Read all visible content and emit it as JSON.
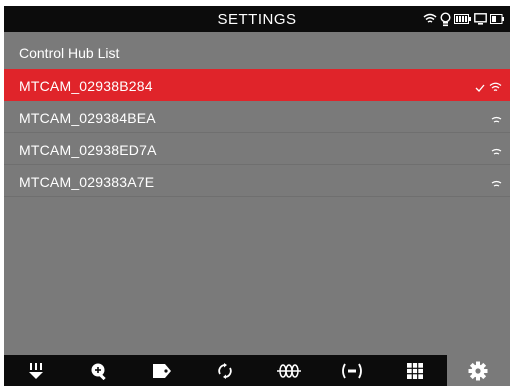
{
  "header": {
    "title": "SETTINGS"
  },
  "status_icons": [
    "wifi-icon",
    "lightbulb-icon",
    "battery-icon",
    "monitor-icon",
    "camera-battery-icon"
  ],
  "list": {
    "heading": "Control Hub List",
    "hubs": [
      {
        "name": "MTCAM_02938B284",
        "selected": true,
        "connected": true,
        "icon": "wifi-icon"
      },
      {
        "name": "MTCAM_029384BEA",
        "selected": false,
        "connected": false,
        "icon": "wifi-icon"
      },
      {
        "name": "MTCAM_02938ED7A",
        "selected": false,
        "connected": false,
        "icon": "wifi-icon"
      },
      {
        "name": "MTCAM_029383A7E",
        "selected": false,
        "connected": false,
        "icon": "wifi-icon"
      }
    ]
  },
  "toolbar": {
    "items": [
      {
        "icon": "crop-down-icon",
        "active": false
      },
      {
        "icon": "zoom-in-icon",
        "active": false
      },
      {
        "icon": "tag-icon",
        "active": false
      },
      {
        "icon": "rotate-icon",
        "active": false
      },
      {
        "icon": "resistor-icon",
        "active": false
      },
      {
        "icon": "broadcast-icon",
        "active": false
      },
      {
        "icon": "grid-icon",
        "active": false
      },
      {
        "icon": "gear-icon",
        "active": true
      }
    ]
  },
  "colors": {
    "background": "#7a7a7a",
    "bars": "#0c0c0c",
    "selected_row": "#e0242a",
    "text": "#ffffff"
  }
}
